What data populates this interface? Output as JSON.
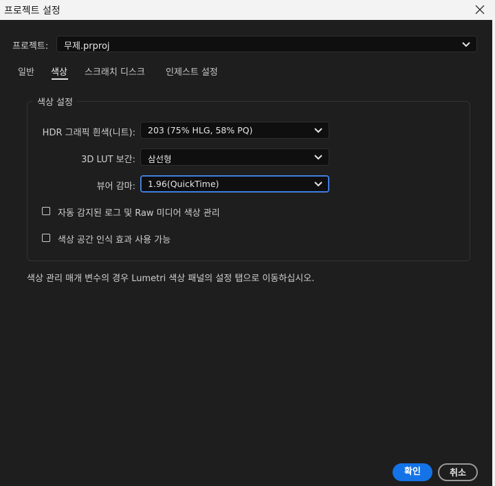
{
  "window": {
    "title": "프로젝트 설정",
    "close_icon": "close-icon"
  },
  "project": {
    "label": "프로젝트:",
    "value": "무제.prproj"
  },
  "tabs": [
    {
      "label": "일반",
      "active": false
    },
    {
      "label": "색상",
      "active": true
    },
    {
      "label": "스크래치 디스크",
      "active": false
    },
    {
      "label": "인제스트 설정",
      "active": false
    }
  ],
  "color_settings": {
    "group_title": "색상 설정",
    "hdr_white": {
      "label": "HDR 그래픽 흰색(니트):",
      "value": "203 (75% HLG, 58% PQ)"
    },
    "lut_interp": {
      "label": "3D LUT 보간:",
      "value": "삼선형"
    },
    "viewer_gamma": {
      "label": "뷰어 감마:",
      "value": "1.96(QuickTime)"
    },
    "checkboxes": [
      {
        "label": "자동 감지된 로그 및 Raw 미디어 색상 관리",
        "checked": false
      },
      {
        "label": "색상 공간 인식 효과 사용 가능",
        "checked": false
      }
    ]
  },
  "note": "색상 관리 매개 변수의 경우 Lumetri 색상 패널의 설정 탭으로 이동하십시오.",
  "buttons": {
    "ok": "확인",
    "cancel": "취소"
  },
  "colors": {
    "accent": "#1473e6",
    "focus_ring": "#4e8ff0",
    "background": "#1e1e1e"
  }
}
